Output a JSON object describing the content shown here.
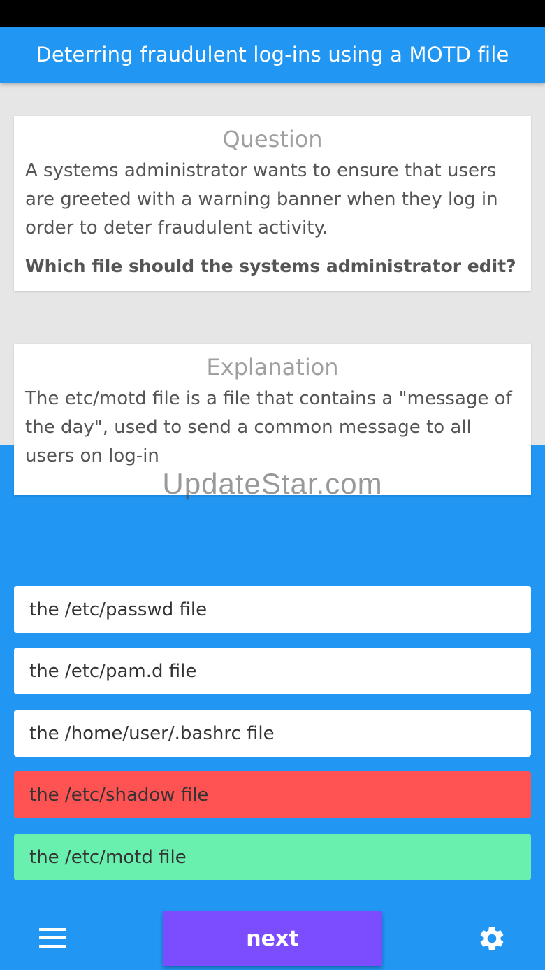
{
  "colors": {
    "primary": "#2196f3",
    "wrong": "#ff5252",
    "correct": "#69f0ae",
    "next_button": "#7c4dff"
  },
  "header": {
    "title": "Deterring fraudulent log-ins using a MOTD file"
  },
  "question": {
    "heading": "Question",
    "text": "A systems administrator wants to ensure that users are greeted with a warning banner when they log in order to deter fraudulent activity.",
    "prompt": "Which file should the systems administrator edit?"
  },
  "explanation": {
    "heading": "Explanation",
    "text": "The etc/motd file is a file that contains a \"message of the day\", used to send a common message to all users on log-in"
  },
  "watermark": "UpdateStar.com",
  "answers": [
    {
      "label": "the /etc/passwd file"
    },
    {
      "label": "the /etc/pam.d file"
    },
    {
      "label": "the /home/user/.bashrc file"
    },
    {
      "label": "the /etc/shadow file"
    },
    {
      "label": "the /etc/motd file"
    }
  ],
  "bottom_bar": {
    "next_label": "next",
    "menu_icon": "menu-icon",
    "settings_icon": "gear-icon"
  }
}
